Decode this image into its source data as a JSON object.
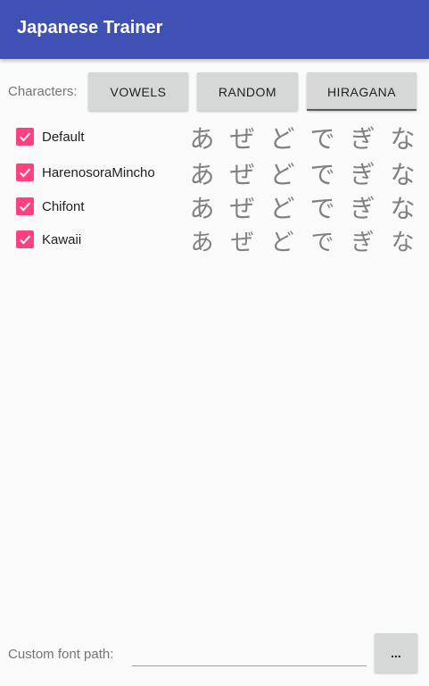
{
  "app": {
    "title": "Japanese Trainer",
    "primary_color": "#3f51b5",
    "accent_color": "#ff4081"
  },
  "characters": {
    "label": "Characters:",
    "buttons": [
      {
        "label": "VOWELS",
        "active": false
      },
      {
        "label": "RANDOM",
        "active": false
      },
      {
        "label": "HIRAGANA",
        "active": true
      }
    ]
  },
  "fonts": [
    {
      "name": "Default",
      "checked": true,
      "preview": [
        "あ",
        "ぜ",
        "ど",
        "で",
        "ぎ",
        "な"
      ]
    },
    {
      "name": "HarenosoraMincho",
      "checked": true,
      "preview": [
        "あ",
        "ぜ",
        "ど",
        "で",
        "ぎ",
        "な"
      ]
    },
    {
      "name": "Chifont",
      "checked": true,
      "preview": [
        "あ",
        "ぜ",
        "ど",
        "で",
        "ぎ",
        "な"
      ]
    },
    {
      "name": "Kawaii",
      "checked": true,
      "preview": [
        "あ",
        "ぜ",
        "ど",
        "で",
        "ぎ",
        "な"
      ]
    }
  ],
  "custom_font": {
    "label": "Custom font path:",
    "value": "",
    "browse_label": "..."
  },
  "icons": {
    "checkbox": "check-icon"
  }
}
